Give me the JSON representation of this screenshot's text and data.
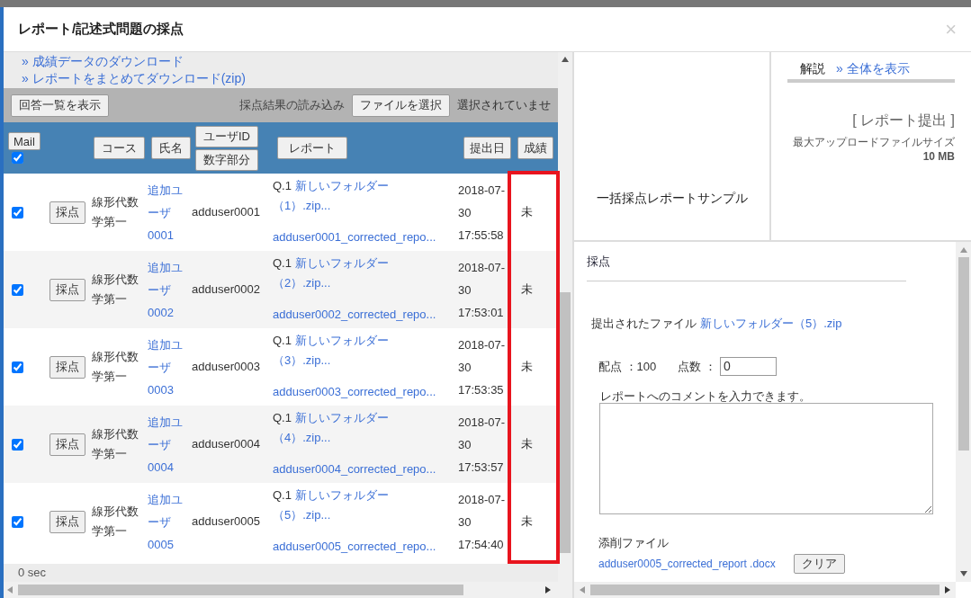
{
  "window": {
    "title": "レポート/記述式問題の採点",
    "close": "×"
  },
  "links": [
    "» 成績データのダウンロード",
    "» レポートをまとめてダウンロード(zip)"
  ],
  "toolbar": {
    "list_button": "回答一覧を表示",
    "import_label": "採点結果の読み込み",
    "file_button": "ファイルを選択",
    "file_status": "選択されていませ"
  },
  "header": {
    "mail_button": "Mail",
    "mail_checked": true,
    "course": "コース",
    "name": "氏名",
    "user_id": "ユーザID",
    "number_part": "数字部分",
    "report": "レポート",
    "date": "提出日",
    "grade": "成績"
  },
  "rows": [
    {
      "checked": true,
      "grade_button": "採点",
      "course": "線形代数学第一",
      "name": "追加ユーザ0001",
      "user_id": "adduser0001",
      "question": "Q.1",
      "file": "新しいフォルダー（1）.zip...",
      "corrected": "adduser0001_corrected_repo...",
      "date": [
        "2018-07-",
        "30",
        "17:55:58"
      ],
      "grade": "未"
    },
    {
      "checked": true,
      "grade_button": "採点",
      "course": "線形代数学第一",
      "name": "追加ユーザ0002",
      "user_id": "adduser0002",
      "question": "Q.1",
      "file": "新しいフォルダー（2）.zip...",
      "corrected": "adduser0002_corrected_repo...",
      "date": [
        "2018-07-",
        "30",
        "17:53:01"
      ],
      "grade": "未"
    },
    {
      "checked": true,
      "grade_button": "採点",
      "course": "線形代数学第一",
      "name": "追加ユーザ0003",
      "user_id": "adduser0003",
      "question": "Q.1",
      "file": "新しいフォルダー（3）.zip...",
      "corrected": "adduser0003_corrected_repo...",
      "date": [
        "2018-07-",
        "30",
        "17:53:35"
      ],
      "grade": "未"
    },
    {
      "checked": true,
      "grade_button": "採点",
      "course": "線形代数学第一",
      "name": "追加ユーザ0004",
      "user_id": "adduser0004",
      "question": "Q.1",
      "file": "新しいフォルダー（4）.zip...",
      "corrected": "adduser0004_corrected_repo...",
      "date": [
        "2018-07-",
        "30",
        "17:53:57"
      ],
      "grade": "未"
    },
    {
      "checked": true,
      "grade_button": "採点",
      "course": "線形代数学第一",
      "name": "追加ユーザ0005",
      "user_id": "adduser0005",
      "question": "Q.1",
      "file": "新しいフォルダー（5）.zip...",
      "corrected": "adduser0005_corrected_repo...",
      "date": [
        "2018-07-",
        "30",
        "17:54:40"
      ],
      "grade": "未"
    }
  ],
  "footer": "0 sec",
  "preview": {
    "title": "一括採点レポートサンプル"
  },
  "info": {
    "tabs": [
      {
        "label": "解説",
        "selected": true
      }
    ],
    "show_all": "» 全体を表示",
    "heading": "[ レポート提出 ]",
    "max_size": "最大アップロードファイルサイズ **10 MB**"
  },
  "grading": {
    "heading": "採点",
    "submitted_label": "提出されたファイル",
    "submitted_file": "新しいフォルダー（5）.zip",
    "full_marks": "配点 ：100",
    "score_label": "点数 ：",
    "score_value": "0",
    "comment_label": "レポートへのコメントを入力できます。",
    "corrected_label": "添削ファイル",
    "corrected_file": "adduser0005_corrected_report .docx",
    "clear_button": "クリア"
  }
}
